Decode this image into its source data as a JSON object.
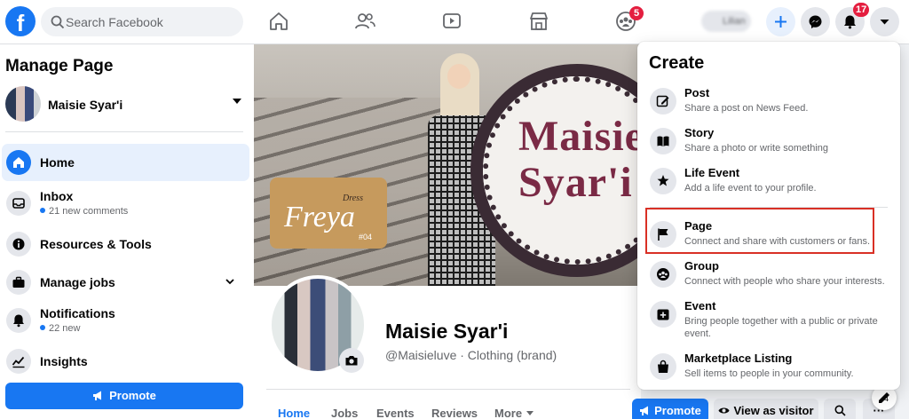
{
  "topbar": {
    "logo": "f",
    "search": {
      "placeholder": "Search Facebook"
    },
    "nav": [
      {
        "name": "home-icon"
      },
      {
        "name": "friends-icon"
      },
      {
        "name": "watch-icon"
      },
      {
        "name": "marketplace-icon"
      },
      {
        "name": "groups-icon",
        "badge": "5"
      }
    ],
    "profile_name": "Lilian",
    "notifications_badge": "17"
  },
  "sidebar": {
    "title": "Manage Page",
    "page_name": "Maisie Syar'i",
    "items": [
      {
        "label": "Home",
        "icon": "home-icon",
        "active": true
      },
      {
        "label": "Inbox",
        "icon": "inbox-icon",
        "sub": "21 new comments"
      },
      {
        "label": "Resources & Tools",
        "icon": "info-icon"
      },
      {
        "label": "Manage jobs",
        "icon": "briefcase-icon"
      },
      {
        "label": "Notifications",
        "icon": "bell-icon",
        "sub": "22 new"
      },
      {
        "label": "Insights",
        "icon": "insights-icon"
      }
    ],
    "promote_label": "Promote"
  },
  "cover": {
    "brand_line1": "Maisie",
    "brand_line2": "Syar'i",
    "dress_label": "Dress",
    "dress_name": "Freya",
    "dress_number": "#04"
  },
  "profile": {
    "name": "Maisie Syar'i",
    "handle": "@Maisieluve · Clothing (brand)",
    "tabs": [
      "Home",
      "Jobs",
      "Events",
      "Reviews",
      "More"
    ],
    "promote_label": "Promote",
    "view_as_visitor_label": "View as visitor",
    "more_label": "···",
    "chat_count": "4"
  },
  "create_menu": {
    "title": "Create",
    "items": [
      {
        "title": "Post",
        "desc": "Share a post on News Feed.",
        "icon": "edit-icon"
      },
      {
        "title": "Story",
        "desc": "Share a photo or write something",
        "icon": "book-icon"
      },
      {
        "title": "Life Event",
        "desc": "Add a life event to your profile.",
        "icon": "star-icon"
      },
      {
        "title": "Page",
        "desc": "Connect and share with customers or fans.",
        "icon": "flag-icon"
      },
      {
        "title": "Group",
        "desc": "Connect with people who share your interests.",
        "icon": "group-icon"
      },
      {
        "title": "Event",
        "desc": "Bring people together with a public or private event.",
        "icon": "calendar-plus-icon"
      },
      {
        "title": "Marketplace Listing",
        "desc": "Sell items to people in your community.",
        "icon": "shopping-bag-icon"
      }
    ]
  },
  "colors": {
    "brand_blue": "#1877f2",
    "highlight": "#d93025",
    "badge_red": "#e41e3f"
  }
}
